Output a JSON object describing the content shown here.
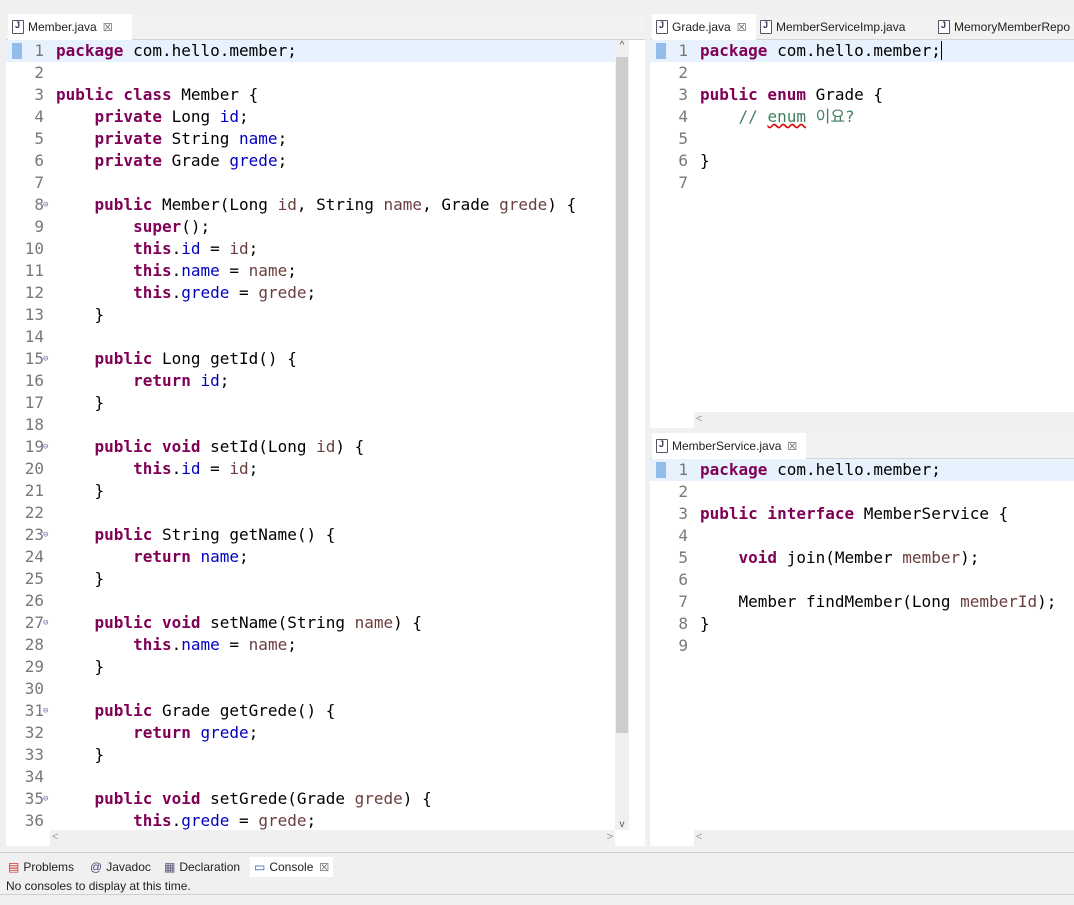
{
  "left_editor": {
    "tabs": [
      {
        "label": "Member.java",
        "close": "☒"
      }
    ],
    "lines": [
      {
        "n": "1",
        "html": "<span class='kw'>package</span> com.hello.member;"
      },
      {
        "n": "2",
        "html": ""
      },
      {
        "n": "3",
        "html": "<span class='kw'>public class</span> Member {"
      },
      {
        "n": "4",
        "html": "    <span class='kw'>private</span> Long <span class='fld'>id</span>;"
      },
      {
        "n": "5",
        "html": "    <span class='kw'>private</span> String <span class='fld'>name</span>;"
      },
      {
        "n": "6",
        "html": "    <span class='kw'>private</span> Grade <span class='fld'>grede</span>;"
      },
      {
        "n": "7",
        "html": ""
      },
      {
        "n": "8",
        "fold": true,
        "html": "    <span class='kw'>public</span> Member(Long <span class='par'>id</span>, String <span class='par'>name</span>, Grade <span class='par'>grede</span>) {"
      },
      {
        "n": "9",
        "html": "        <span class='kw'>super</span>();"
      },
      {
        "n": "10",
        "html": "        <span class='kw'>this</span>.<span class='fld'>id</span> = <span class='par'>id</span>;"
      },
      {
        "n": "11",
        "html": "        <span class='kw'>this</span>.<span class='fld'>name</span> = <span class='par'>name</span>;"
      },
      {
        "n": "12",
        "html": "        <span class='kw'>this</span>.<span class='fld'>grede</span> = <span class='par'>grede</span>;"
      },
      {
        "n": "13",
        "html": "    }"
      },
      {
        "n": "14",
        "html": ""
      },
      {
        "n": "15",
        "fold": true,
        "html": "    <span class='kw'>public</span> Long getId() {"
      },
      {
        "n": "16",
        "html": "        <span class='kw'>return</span> <span class='fld'>id</span>;"
      },
      {
        "n": "17",
        "html": "    }"
      },
      {
        "n": "18",
        "html": ""
      },
      {
        "n": "19",
        "fold": true,
        "html": "    <span class='kw'>public void</span> setId(Long <span class='par'>id</span>) {"
      },
      {
        "n": "20",
        "html": "        <span class='kw'>this</span>.<span class='fld'>id</span> = <span class='par'>id</span>;"
      },
      {
        "n": "21",
        "html": "    }"
      },
      {
        "n": "22",
        "html": ""
      },
      {
        "n": "23",
        "fold": true,
        "html": "    <span class='kw'>public</span> String getName() {"
      },
      {
        "n": "24",
        "html": "        <span class='kw'>return</span> <span class='fld'>name</span>;"
      },
      {
        "n": "25",
        "html": "    }"
      },
      {
        "n": "26",
        "html": ""
      },
      {
        "n": "27",
        "fold": true,
        "html": "    <span class='kw'>public void</span> setName(String <span class='par'>name</span>) {"
      },
      {
        "n": "28",
        "html": "        <span class='kw'>this</span>.<span class='fld'>name</span> = <span class='par'>name</span>;"
      },
      {
        "n": "29",
        "html": "    }"
      },
      {
        "n": "30",
        "html": ""
      },
      {
        "n": "31",
        "fold": true,
        "html": "    <span class='kw'>public</span> Grade getGrede() {"
      },
      {
        "n": "32",
        "html": "        <span class='kw'>return</span> <span class='fld'>grede</span>;"
      },
      {
        "n": "33",
        "html": "    }"
      },
      {
        "n": "34",
        "html": ""
      },
      {
        "n": "35",
        "fold": true,
        "html": "    <span class='kw'>public void</span> setGrede(Grade <span class='par'>grede</span>) {"
      },
      {
        "n": "36",
        "html": "        <span class='kw'>this</span>.<span class='fld'>grede</span> = <span class='par'>grede</span>;"
      }
    ]
  },
  "top_right_editor": {
    "tabs": [
      {
        "label": "Grade.java",
        "close": "☒"
      },
      {
        "label": "MemberServiceImp.java"
      },
      {
        "label": "MemoryMemberRepo"
      }
    ],
    "lines": [
      {
        "n": "1",
        "html": "<span class='kw'>package</span> com.hello.member;<span style='border-left:1px solid #000;'></span>"
      },
      {
        "n": "2",
        "html": ""
      },
      {
        "n": "3",
        "html": "<span class='kw'>public enum</span> Grade {"
      },
      {
        "n": "4",
        "html": "    <span class='cmt'>// <span class='sq'>enum</span> 이요?</span>"
      },
      {
        "n": "5",
        "html": ""
      },
      {
        "n": "6",
        "html": "}"
      },
      {
        "n": "7",
        "html": ""
      }
    ]
  },
  "bottom_right_editor": {
    "tabs": [
      {
        "label": "MemberService.java",
        "close": "☒"
      }
    ],
    "lines": [
      {
        "n": "1",
        "html": "<span class='kw'>package</span> com.hello.member;"
      },
      {
        "n": "2",
        "html": ""
      },
      {
        "n": "3",
        "html": "<span class='kw'>public interface</span> MemberService {"
      },
      {
        "n": "4",
        "html": ""
      },
      {
        "n": "5",
        "html": "    <span class='kw'>void</span> join(Member <span class='par'>member</span>);"
      },
      {
        "n": "6",
        "html": ""
      },
      {
        "n": "7",
        "html": "    Member findMember(Long <span class='par'>memberId</span>);"
      },
      {
        "n": "8",
        "html": "}"
      },
      {
        "n": "9",
        "html": ""
      }
    ]
  },
  "bottom_panel": {
    "tabs": [
      {
        "label": "Problems",
        "icon": "problems-icon"
      },
      {
        "label": "Javadoc",
        "icon": "javadoc-icon"
      },
      {
        "label": "Declaration",
        "icon": "declaration-icon"
      },
      {
        "label": "Console",
        "icon": "console-icon",
        "close": "☒"
      }
    ],
    "message": "No consoles to display at this time."
  }
}
